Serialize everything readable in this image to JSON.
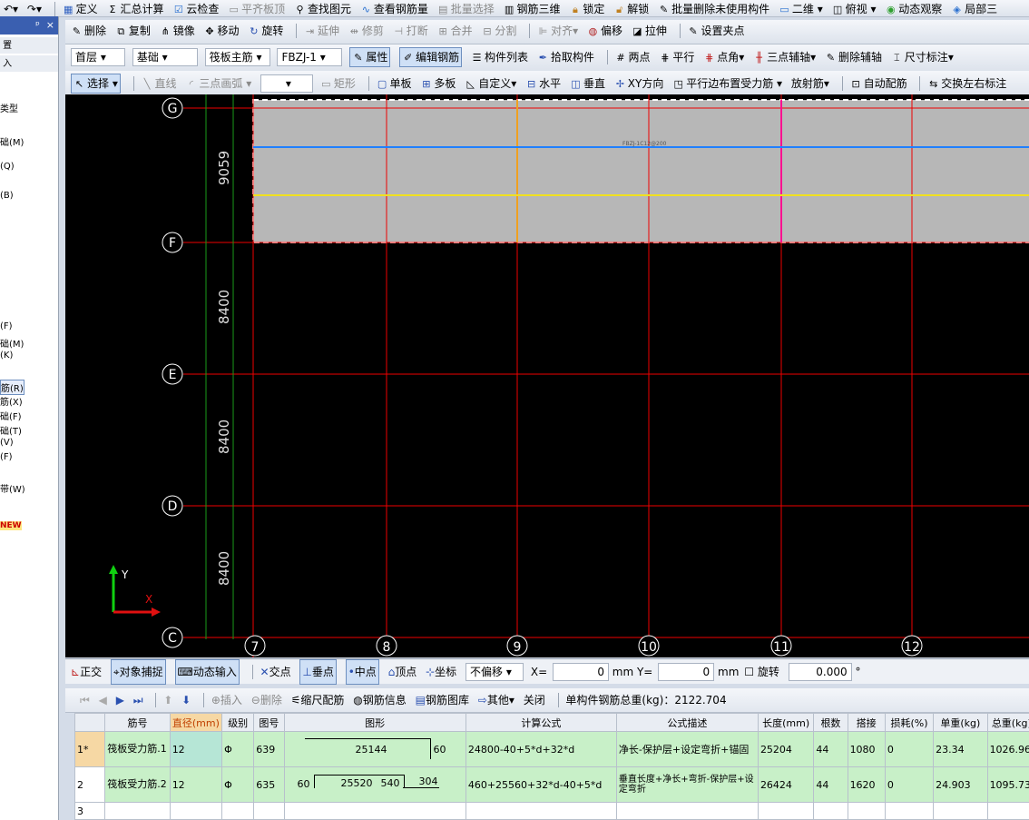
{
  "top_toolbar": {
    "items": [
      "定义",
      "汇总计算",
      "云检查",
      "平齐板顶",
      "查找图元",
      "查看钢筋量",
      "批量选择",
      "钢筋三维",
      "锁定",
      "解锁",
      "批量删除未使用构件",
      "二维",
      "俯视",
      "动态观察",
      "局部三"
    ]
  },
  "edit_toolbar": {
    "items": [
      "删除",
      "复制",
      "镜像",
      "移动",
      "旋转",
      "延伸",
      "修剪",
      "打断",
      "合并",
      "分割",
      "对齐",
      "偏移",
      "拉伸",
      "设置夹点"
    ]
  },
  "component_bar": {
    "floor": "首层",
    "category": "基础",
    "type": "筏板主筋",
    "name": "FBZJ-1",
    "buttons": [
      "属性",
      "编辑钢筋",
      "构件列表",
      "拾取构件"
    ],
    "axis_tools": [
      "两点",
      "平行",
      "点角",
      "三点辅轴",
      "删除辅轴",
      "尺寸标注"
    ]
  },
  "draw_toolbar": {
    "items": [
      "选择",
      "直线",
      "三点画弧",
      "矩形",
      "单板",
      "多板",
      "自定义",
      "水平",
      "垂直",
      "XY方向",
      "平行边布置受力筋",
      "放射筋",
      "自动配筋",
      "交换左右标注"
    ]
  },
  "left_panel": {
    "header_icons": [
      "ᵖ",
      "×"
    ],
    "items": [
      "类型",
      "础(M)",
      "(Q)",
      "(B)",
      "(F)",
      "础(M)",
      "(K)",
      "筋(R)",
      "筋(X)",
      "础(F)",
      "础(T)",
      "(V)",
      "(F)",
      "带(W)",
      "NEW"
    ]
  },
  "canvas": {
    "label": "FBZJ-1C12@200",
    "row_axes": [
      "G",
      "F",
      "E",
      "D",
      "C"
    ],
    "col_axes": [
      "7",
      "8",
      "9",
      "10",
      "11",
      "12"
    ],
    "dims": [
      "9059",
      "8400",
      "8400",
      "8400"
    ],
    "y_label": "Y",
    "x_label": "X"
  },
  "status_bar": {
    "items": [
      "正交",
      "对象捕捉",
      "动态输入",
      "交点",
      "垂点",
      "中点",
      "顶点",
      "坐标"
    ],
    "offset_mode": "不偏移",
    "x_label": "X=",
    "x_value": "0",
    "y_label": "mm Y=",
    "y_value": "0",
    "mm": "mm",
    "rotate_label": "旋转",
    "rotate_value": "0.000",
    "degree": "°"
  },
  "rebar_toolbar": {
    "items": [
      "插入",
      "删除",
      "缩尺配筋",
      "钢筋信息",
      "钢筋图库",
      "其他",
      "关闭"
    ],
    "total_weight": "单构件钢筋总重(kg)：2122.704"
  },
  "rebar_table": {
    "headers": [
      "筋号",
      "直径(mm)",
      "级别",
      "图号",
      "图形",
      "计算公式",
      "公式描述",
      "长度(mm)",
      "根数",
      "搭接",
      "损耗(%)",
      "单重(kg)",
      "总重(kg)"
    ],
    "rows": [
      {
        "num": "1*",
        "name": "筏板受力筋.1",
        "dia": "12",
        "grade": "Φ",
        "fig": "639",
        "shape_main": "25144",
        "shape_end": "60",
        "formula": "24800-40+5*d+32*d",
        "desc": "净长-保护层+设定弯折+锚固",
        "length": "25204",
        "count": "44",
        "lap": "1080",
        "loss": "0",
        "unit_w": "23.34",
        "total_w": "1026.96"
      },
      {
        "num": "2",
        "name": "筏板受力筋.2",
        "dia": "12",
        "grade": "Φ",
        "fig": "635",
        "shape_left": "60",
        "shape_main": "25520",
        "shape_mid": "540",
        "shape_end": "304",
        "formula": "460+25560+32*d-40+5*d",
        "desc": "垂直长度+净长+弯折-保护层+设定弯折",
        "length": "26424",
        "count": "44",
        "lap": "1620",
        "loss": "0",
        "unit_w": "24.903",
        "total_w": "1095.73"
      },
      {
        "num": "3"
      }
    ]
  }
}
